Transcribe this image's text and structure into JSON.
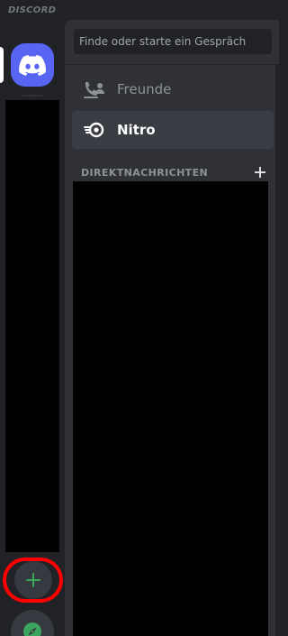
{
  "app": {
    "wordmark": "DISCORD"
  },
  "rail": {
    "home_icon": "discord-logo-icon",
    "add_server_icon": "plus-icon",
    "explore_icon": "compass-icon",
    "highlight_color": "#ff0000",
    "accent_color": "#5865f2",
    "green_color": "#3ba55d"
  },
  "search": {
    "placeholder": "Finde oder starte ein Gespräch"
  },
  "nav": {
    "friends": {
      "label": "Freunde",
      "icon": "friends-wave-icon"
    },
    "nitro": {
      "label": "Nitro",
      "icon": "nitro-icon"
    }
  },
  "dm": {
    "title": "DIREKTNACHRICHTEN",
    "add_icon": "plus-icon"
  }
}
